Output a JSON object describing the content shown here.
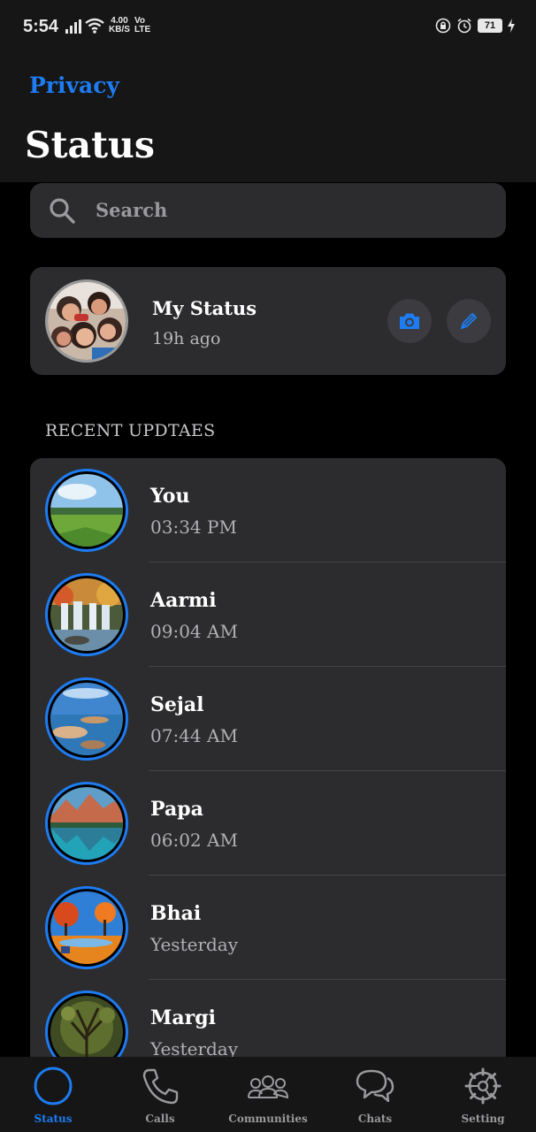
{
  "statusbar": {
    "time": "5:54",
    "speed_value": "4.00",
    "speed_unit": "KB/S",
    "volte_top": "Vo",
    "volte_bottom": "LTE",
    "battery": "71"
  },
  "header": {
    "back_link": "Privacy",
    "title": "Status"
  },
  "search": {
    "placeholder": "Search",
    "icon": "search-icon"
  },
  "my_status": {
    "name": "My Status",
    "time": "19h ago",
    "actions": [
      "camera-icon",
      "pencil-icon"
    ]
  },
  "section_title": "RECENT UPDTAES",
  "recent": [
    {
      "name": "You",
      "time": "03:34 PM"
    },
    {
      "name": "Aarmi",
      "time": "09:04 AM"
    },
    {
      "name": "Sejal",
      "time": "07:44 AM"
    },
    {
      "name": "Papa",
      "time": "06:02 AM"
    },
    {
      "name": "Bhai",
      "time": "Yesterday"
    },
    {
      "name": "Margi",
      "time": "Yesterday"
    }
  ],
  "nav": [
    {
      "label": "Status",
      "icon": "status-ring-icon",
      "active": true
    },
    {
      "label": "Calls",
      "icon": "phone-icon",
      "active": false
    },
    {
      "label": "Communities",
      "icon": "communities-icon",
      "active": false
    },
    {
      "label": "Chats",
      "icon": "chat-bubbles-icon",
      "active": false
    },
    {
      "label": "Setting",
      "icon": "gear-icon",
      "active": false
    }
  ],
  "colors": {
    "accent": "#1d7cf2",
    "card": "#2c2c2e",
    "header": "#161616",
    "background": "#000000"
  }
}
